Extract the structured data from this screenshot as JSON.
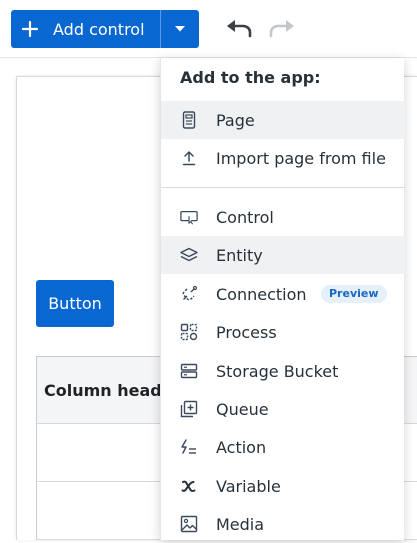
{
  "toolbar": {
    "add_control_label": "Add control"
  },
  "canvas": {
    "button_label": "Button",
    "table": {
      "header": "Column heading"
    }
  },
  "dropdown": {
    "header": "Add to the app:",
    "items": [
      {
        "label": "Page",
        "icon": "page-icon"
      },
      {
        "label": "Import page from file",
        "icon": "upload-icon"
      },
      {
        "label": "Control",
        "icon": "control-icon"
      },
      {
        "label": "Entity",
        "icon": "layers-icon"
      },
      {
        "label": "Connection",
        "icon": "connection-icon",
        "badge": "Preview"
      },
      {
        "label": "Process",
        "icon": "process-icon"
      },
      {
        "label": "Storage Bucket",
        "icon": "storage-icon"
      },
      {
        "label": "Queue",
        "icon": "queue-icon"
      },
      {
        "label": "Action",
        "icon": "action-icon"
      },
      {
        "label": "Variable",
        "icon": "variable-icon"
      },
      {
        "label": "Media",
        "icon": "media-icon"
      }
    ]
  },
  "colors": {
    "primary": "#0967d2",
    "text": "#273139",
    "highlight": "#f0f1f3",
    "badge_bg": "#e5f0fb",
    "badge_text": "#1867c4"
  }
}
